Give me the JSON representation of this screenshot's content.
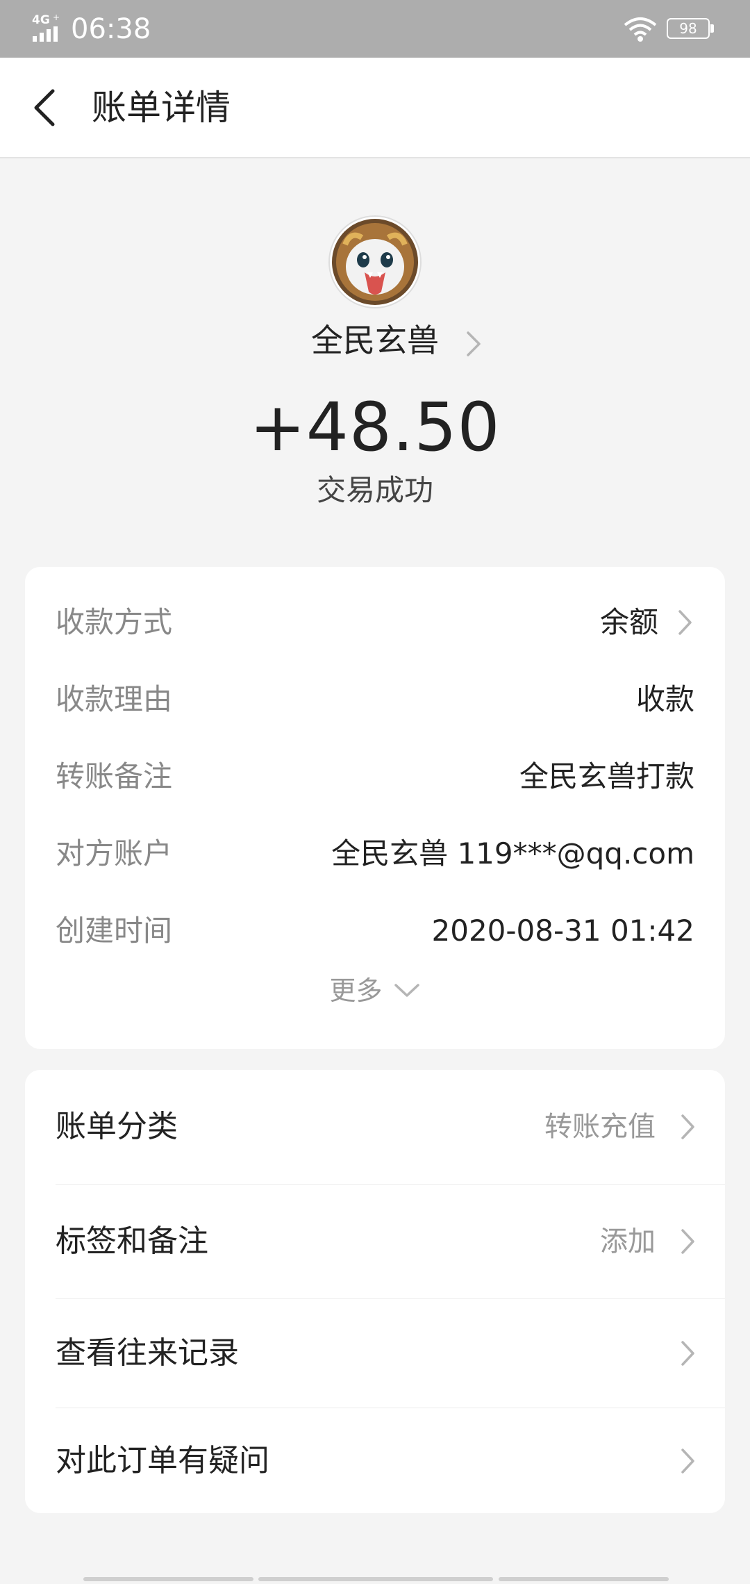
{
  "status_bar": {
    "network": "4G",
    "time": "06:38",
    "battery": "98"
  },
  "header": {
    "title": "账单详情"
  },
  "summary": {
    "payee_name": "全民玄兽",
    "amount": "+48.50",
    "status": "交易成功"
  },
  "details": [
    {
      "label": "收款方式",
      "value": "余额",
      "arrow": true
    },
    {
      "label": "收款理由",
      "value": "收款",
      "arrow": false
    },
    {
      "label": "转账备注",
      "value": "全民玄兽打款",
      "arrow": false
    },
    {
      "label": "对方账户",
      "value": "全民玄兽 119***@qq.com",
      "arrow": false
    },
    {
      "label": "创建时间",
      "value": "2020-08-31 01:42",
      "arrow": false
    }
  ],
  "more_label": "更多",
  "menu": [
    {
      "label": "账单分类",
      "value": "转账充值"
    },
    {
      "label": "标签和备注",
      "value": "添加"
    },
    {
      "label": "查看往来记录",
      "value": ""
    },
    {
      "label": "对此订单有疑问",
      "value": ""
    }
  ],
  "colors": {
    "status_bar_bg": "#adadad",
    "page_bg": "#f4f4f4",
    "card_bg": "#ffffff",
    "muted_text": "#888888"
  }
}
